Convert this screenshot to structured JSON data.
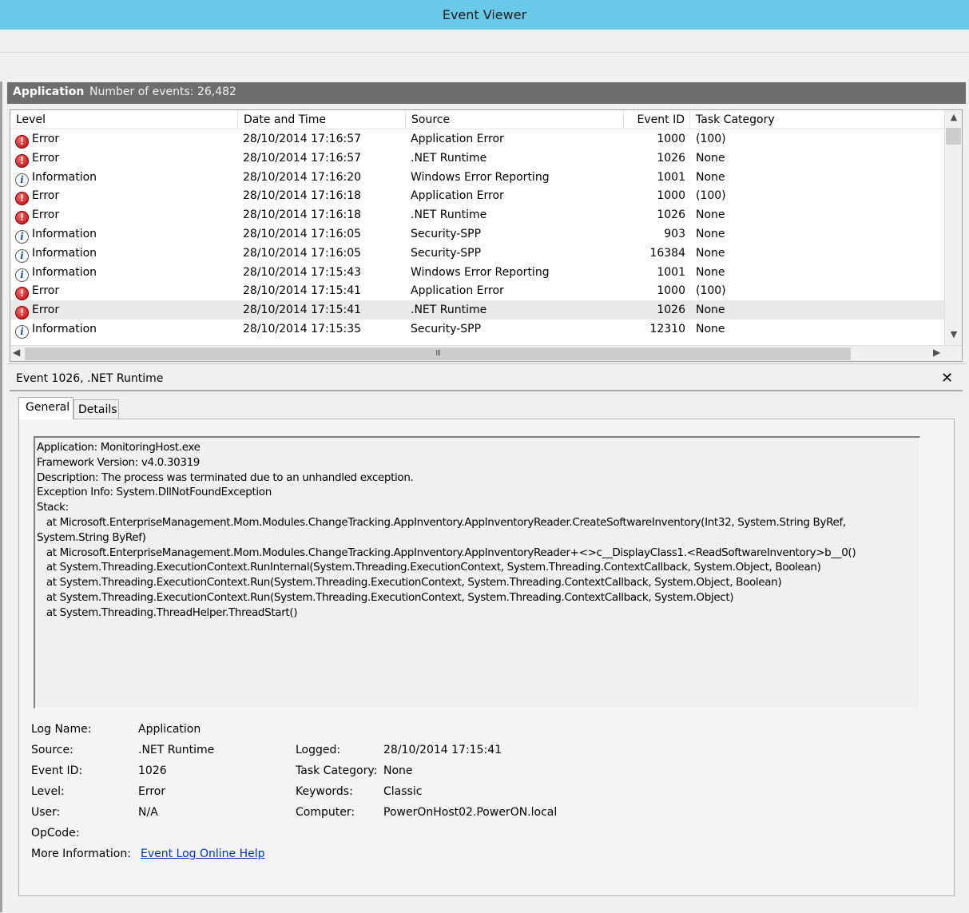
{
  "window": {
    "title": "Event Viewer"
  },
  "log_header": {
    "name": "Application",
    "count_text": "Number of events: 26,482"
  },
  "columns": {
    "level": "Level",
    "date": "Date and Time",
    "source": "Source",
    "event_id": "Event ID",
    "task_category": "Task Category"
  },
  "events": [
    {
      "level": "Error",
      "date": "28/10/2014 17:16:57",
      "source": "Application Error",
      "event_id": "1000",
      "category": "(100)"
    },
    {
      "level": "Error",
      "date": "28/10/2014 17:16:57",
      "source": ".NET Runtime",
      "event_id": "1026",
      "category": "None"
    },
    {
      "level": "Information",
      "date": "28/10/2014 17:16:20",
      "source": "Windows Error Reporting",
      "event_id": "1001",
      "category": "None"
    },
    {
      "level": "Error",
      "date": "28/10/2014 17:16:18",
      "source": "Application Error",
      "event_id": "1000",
      "category": "(100)"
    },
    {
      "level": "Error",
      "date": "28/10/2014 17:16:18",
      "source": ".NET Runtime",
      "event_id": "1026",
      "category": "None"
    },
    {
      "level": "Information",
      "date": "28/10/2014 17:16:05",
      "source": "Security-SPP",
      "event_id": "903",
      "category": "None"
    },
    {
      "level": "Information",
      "date": "28/10/2014 17:16:05",
      "source": "Security-SPP",
      "event_id": "16384",
      "category": "None"
    },
    {
      "level": "Information",
      "date": "28/10/2014 17:15:43",
      "source": "Windows Error Reporting",
      "event_id": "1001",
      "category": "None"
    },
    {
      "level": "Error",
      "date": "28/10/2014 17:15:41",
      "source": "Application Error",
      "event_id": "1000",
      "category": "(100)"
    },
    {
      "level": "Error",
      "date": "28/10/2014 17:15:41",
      "source": ".NET Runtime",
      "event_id": "1026",
      "category": "None"
    },
    {
      "level": "Information",
      "date": "28/10/2014 17:15:35",
      "source": "Security-SPP",
      "event_id": "12310",
      "category": "None"
    }
  ],
  "selected_row": 9,
  "scrollbar": {
    "h_thumb_glyph": "III"
  },
  "detail": {
    "title": "Event 1026, .NET Runtime",
    "close_glyph": "✕",
    "tabs": {
      "general": "General",
      "details": "Details"
    },
    "description": "Application: MonitoringHost.exe\nFramework Version: v4.0.30319\nDescription: The process was terminated due to an unhandled exception.\nException Info: System.DllNotFoundException\nStack:\n   at Microsoft.EnterpriseManagement.Mom.Modules.ChangeTracking.AppInventory.AppInventoryReader.CreateSoftwareInventory(Int32, System.String ByRef,\nSystem.String ByRef)\n   at Microsoft.EnterpriseManagement.Mom.Modules.ChangeTracking.AppInventory.AppInventoryReader+<>c__DisplayClass1.<ReadSoftwareInventory>b__0()\n   at System.Threading.ExecutionContext.RunInternal(System.Threading.ExecutionContext, System.Threading.ContextCallback, System.Object, Boolean)\n   at System.Threading.ExecutionContext.Run(System.Threading.ExecutionContext, System.Threading.ContextCallback, System.Object, Boolean)\n   at System.Threading.ExecutionContext.Run(System.Threading.ExecutionContext, System.Threading.ContextCallback, System.Object)\n   at System.Threading.ThreadHelper.ThreadStart()",
    "props": {
      "log_name_label": "Log Name:",
      "log_name": "Application",
      "source_label": "Source:",
      "source": ".NET Runtime",
      "logged_label": "Logged:",
      "logged": "28/10/2014 17:15:41",
      "event_id_label": "Event ID:",
      "event_id": "1026",
      "task_category_label": "Task Category:",
      "task_category": "None",
      "level_label": "Level:",
      "level": "Error",
      "keywords_label": "Keywords:",
      "keywords": "Classic",
      "user_label": "User:",
      "user": "N/A",
      "computer_label": "Computer:",
      "computer": "PowerOnHost02.PowerON.local",
      "opcode_label": "OpCode:",
      "more_info_label": "More Information:",
      "more_info_link": "Event Log Online Help"
    }
  }
}
